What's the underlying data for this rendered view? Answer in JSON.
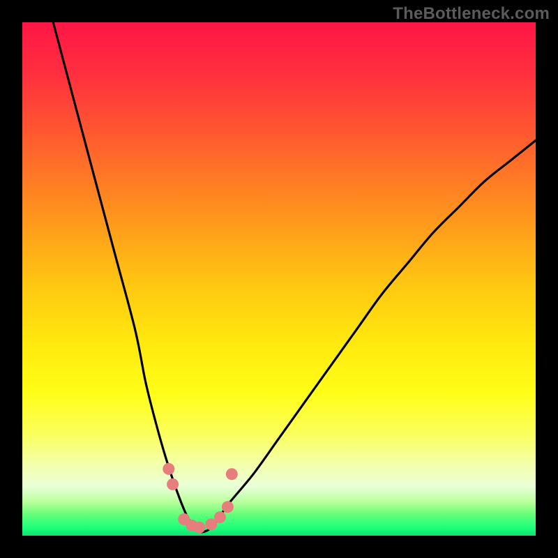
{
  "watermark": "TheBottleneck.com",
  "colors": {
    "background": "#000000",
    "curve": "#000000",
    "dots": "#e77e7e",
    "gradient_stops": [
      {
        "offset": 0.0,
        "color": "#ff1646"
      },
      {
        "offset": 0.1,
        "color": "#ff2f3f"
      },
      {
        "offset": 0.22,
        "color": "#ff5a2f"
      },
      {
        "offset": 0.35,
        "color": "#ff8a20"
      },
      {
        "offset": 0.5,
        "color": "#ffc312"
      },
      {
        "offset": 0.62,
        "color": "#ffe80e"
      },
      {
        "offset": 0.72,
        "color": "#fffd16"
      },
      {
        "offset": 0.8,
        "color": "#fbff5a"
      },
      {
        "offset": 0.86,
        "color": "#f4ffaa"
      },
      {
        "offset": 0.905,
        "color": "#e8ffd8"
      },
      {
        "offset": 0.935,
        "color": "#b8ff9a"
      },
      {
        "offset": 0.96,
        "color": "#5fff78"
      },
      {
        "offset": 0.985,
        "color": "#1bff7a"
      },
      {
        "offset": 1.0,
        "color": "#10e36f"
      }
    ]
  },
  "chart_data": {
    "type": "line",
    "title": "",
    "xlabel": "",
    "ylabel": "",
    "xlim": [
      0,
      100
    ],
    "ylim": [
      0,
      100
    ],
    "note": "Bottleneck curve: y is mismatch/bottleneck percentage (0 = balanced, 100 = max bottleneck) versus a component/ratio axis. Minimum (optimal balance) is around x≈34.",
    "series": [
      {
        "name": "bottleneck-curve",
        "x": [
          6,
          10,
          14,
          18,
          22,
          24,
          26,
          28,
          30,
          32,
          34,
          36,
          38,
          40,
          45,
          50,
          55,
          60,
          65,
          70,
          75,
          80,
          85,
          90,
          95,
          100
        ],
        "y": [
          100,
          85,
          70,
          55,
          40,
          30,
          22,
          15,
          9,
          4,
          1,
          1,
          3,
          6,
          12,
          19,
          26,
          33,
          40,
          47,
          53,
          59,
          64,
          69,
          73,
          77
        ]
      }
    ],
    "optimal_region": {
      "name": "balanced-range-markers",
      "points": [
        {
          "x": 28.5,
          "y": 13
        },
        {
          "x": 29.3,
          "y": 10
        },
        {
          "x": 31.5,
          "y": 3.2
        },
        {
          "x": 33.0,
          "y": 2.0
        },
        {
          "x": 34.5,
          "y": 1.6
        },
        {
          "x": 36.8,
          "y": 2.2
        },
        {
          "x": 38.5,
          "y": 3.6
        },
        {
          "x": 40.0,
          "y": 5.6
        },
        {
          "x": 40.8,
          "y": 12
        }
      ]
    }
  }
}
